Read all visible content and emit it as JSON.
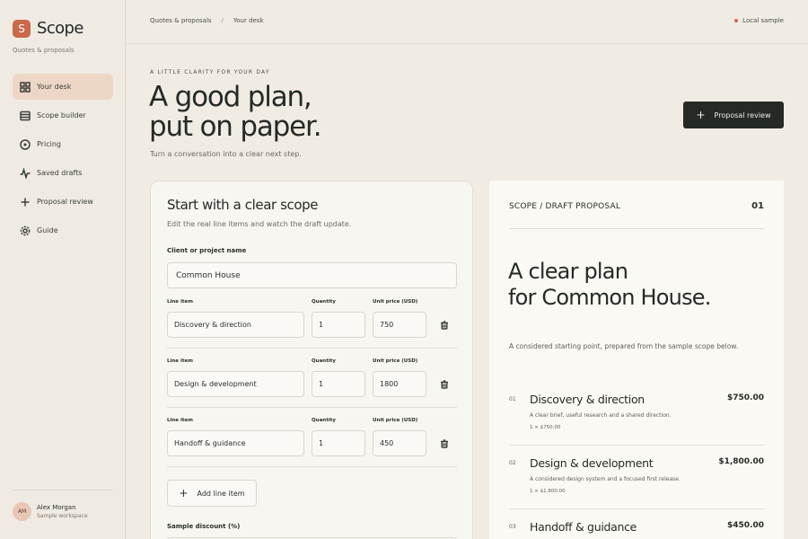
{
  "app": {
    "brand_letter": "S",
    "brand_name": "Scope",
    "brand_subtitle": "Quotes & proposals",
    "accent": "#c9694a",
    "dark": "#252a27"
  },
  "sidebar": {
    "items": [
      {
        "label": "Your desk",
        "icon": "grid-icon",
        "active": true
      },
      {
        "label": "Scope builder",
        "icon": "list-icon"
      },
      {
        "label": "Pricing",
        "icon": "clock-icon"
      },
      {
        "label": "Saved drafts",
        "icon": "pulse-icon"
      },
      {
        "label": "Proposal review",
        "icon": "plus-icon"
      },
      {
        "label": "Guide",
        "icon": "gear-icon"
      }
    ],
    "user": {
      "initials": "AM",
      "name": "Alex Morgan",
      "workspace": "Sample workspace"
    }
  },
  "topbar": {
    "crumb1": "Quotes & proposals",
    "separator": "/",
    "crumb2": "Your desk",
    "status": "Local sample"
  },
  "hero": {
    "eyebrow": "A LITTLE CLARITY FOR YOUR DAY",
    "title_line1": "A good plan,",
    "title_line2": "put on paper.",
    "subtitle": "Turn a conversation into a clear next step.",
    "button_label": "Proposal review"
  },
  "form": {
    "title": "Start with a clear scope",
    "subtitle": "Edit the real line items and watch the draft update.",
    "client_label": "Client or project name",
    "client_value": "Common House",
    "col_item": "Line item",
    "col_qty": "Quantity",
    "col_price": "Unit price (USD)",
    "rows": [
      {
        "item": "Discovery & direction",
        "qty": "1",
        "price": "750"
      },
      {
        "item": "Design & development",
        "qty": "1",
        "price": "1800"
      },
      {
        "item": "Handoff & guidance",
        "qty": "1",
        "price": "450"
      }
    ],
    "add_label": "Add line item",
    "discount_label": "Sample discount (%)"
  },
  "preview": {
    "header": "SCOPE / DRAFT PROPOSAL",
    "number": "01",
    "title_line1": "A clear plan",
    "title_line2": "for Common House.",
    "description": "A considered starting point, prepared from the sample scope below.",
    "items": [
      {
        "idx": "01",
        "name": "Discovery & direction",
        "price": "$750.00",
        "note": "A clear brief, useful research and a shared direction.",
        "calc": "1 × $750.00"
      },
      {
        "idx": "02",
        "name": "Design & development",
        "price": "$1,800.00",
        "note": "A considered design system and a focused first release.",
        "calc": "1 × $1,800.00"
      },
      {
        "idx": "03",
        "name": "Handoff & guidance",
        "price": "$450.00",
        "note": "",
        "calc": ""
      }
    ]
  }
}
